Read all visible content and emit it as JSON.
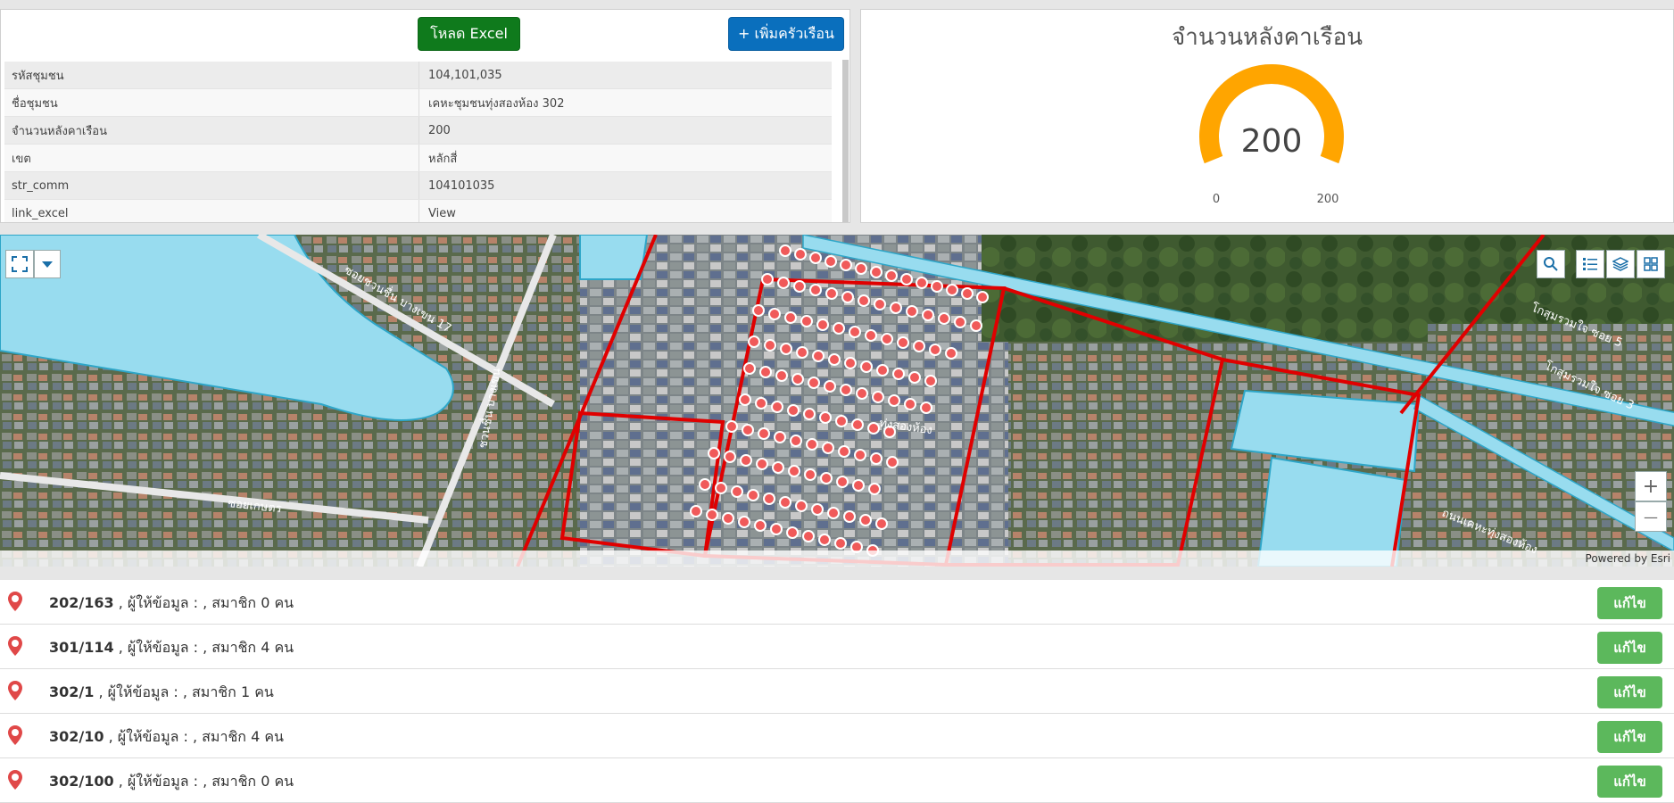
{
  "toolbar": {
    "excel_label": "โหลด Excel",
    "add_label": "+ เพิ่มครัวเรือน"
  },
  "attributes": [
    {
      "key": "รหัสชุมชน",
      "value": "104,101,035"
    },
    {
      "key": "ชื่อชุมชน",
      "value": "เคหะชุมชนทุ่งสองห้อง 302"
    },
    {
      "key": "จำนวนหลังคาเรือน",
      "value": "200"
    },
    {
      "key": "เขต",
      "value": "หลักสี่"
    },
    {
      "key": "str_comm",
      "value": "104101035"
    },
    {
      "key": "link_excel",
      "value": "View"
    }
  ],
  "gauge": {
    "title": "จำนวนหลังคาเรือน",
    "value": "200",
    "min": "0",
    "max": "200",
    "fill_fraction": 1.0,
    "color": "#ffa500"
  },
  "map": {
    "attribution": "Powered by Esri",
    "labels": {
      "road1": "ซอยชวนชื่น บางเขน 17",
      "road2": "ชวนชื่น บางเขน",
      "road3": "ซอยเกษตร",
      "road4": "ทุ่งสองห้อง",
      "road5": "โกสุมรวมใจ ซอย 5",
      "road6": "โกสุมรวมใจ ซอย 3",
      "road7": "ถนนเคหะทุ่งสองห้อง"
    },
    "zoom_in": "+",
    "zoom_out": "—"
  },
  "households": [
    {
      "id": "202/163",
      "info": ", ผู้ให้ข้อมูล : , สมาชิก 0 คน",
      "edit": "แก้ไข"
    },
    {
      "id": "301/114",
      "info": ", ผู้ให้ข้อมูล : , สมาชิก 4 คน",
      "edit": "แก้ไข"
    },
    {
      "id": "302/1",
      "info": ", ผู้ให้ข้อมูล : , สมาชิก 1 คน",
      "edit": "แก้ไข"
    },
    {
      "id": "302/10",
      "info": ", ผู้ให้ข้อมูล : , สมาชิก 4 คน",
      "edit": "แก้ไข"
    },
    {
      "id": "302/100",
      "info": ", ผู้ให้ข้อมูล : , สมาชิก 0 คน",
      "edit": "แก้ไข"
    }
  ]
}
